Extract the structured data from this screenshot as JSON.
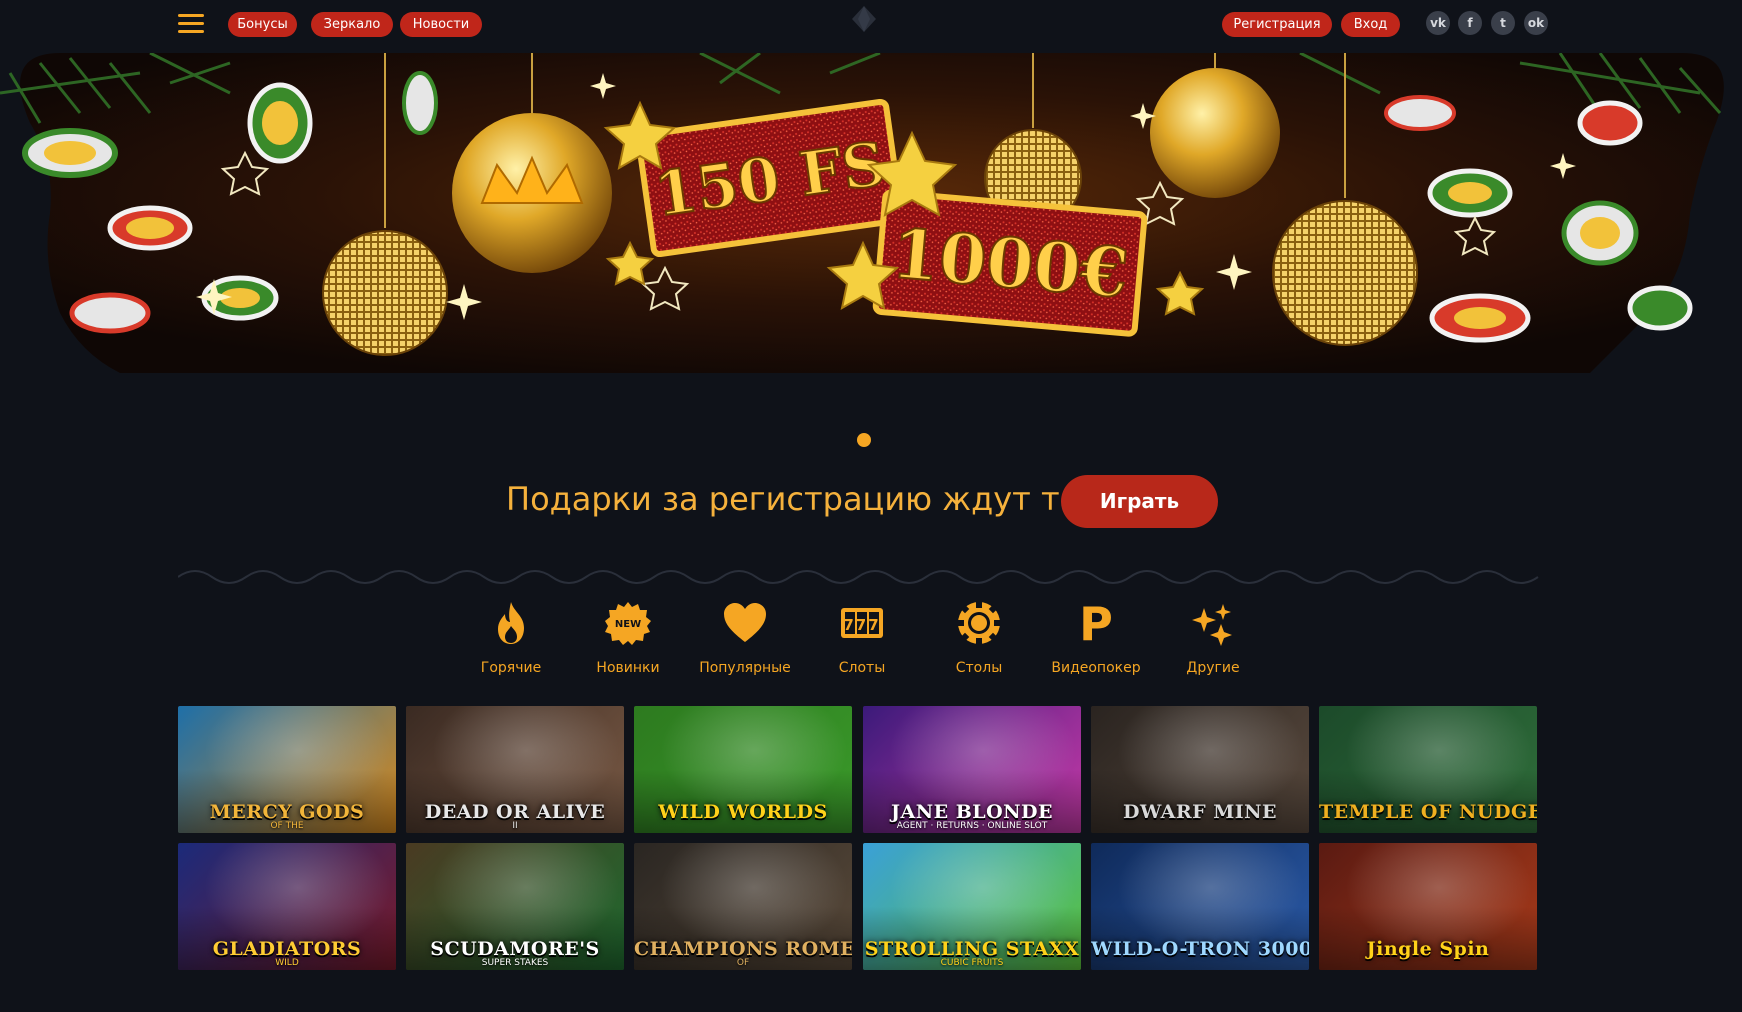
{
  "header": {
    "nav": [
      "Бонусы",
      "Зеркало",
      "Новости"
    ],
    "auth": [
      "Регистрация",
      "Вход"
    ],
    "social": [
      {
        "icon": "vk-icon",
        "glyph": "vk"
      },
      {
        "icon": "facebook-icon",
        "glyph": "f"
      },
      {
        "icon": "twitter-icon",
        "glyph": "t"
      },
      {
        "icon": "odnoklassniki-icon",
        "glyph": "ok"
      }
    ]
  },
  "banner": {
    "free_spins": "150 FS",
    "amount": "1000€"
  },
  "promo": {
    "text": "Подарки за регистрацию ждут тебя!",
    "button": "Играть"
  },
  "categories": [
    {
      "label": "Горячие",
      "icon": "fire-icon"
    },
    {
      "label": "Новинки",
      "icon": "new-badge-icon",
      "badge": "NEW"
    },
    {
      "label": "Популярные",
      "icon": "heart-icon"
    },
    {
      "label": "Слоты",
      "icon": "slot-777-icon",
      "badge": "777"
    },
    {
      "label": "Столы",
      "icon": "casino-chip-icon"
    },
    {
      "label": "Видеопокер",
      "icon": "poker-p-icon",
      "badge": "P"
    },
    {
      "label": "Другие",
      "icon": "sparkles-icon"
    }
  ],
  "games": [
    {
      "title": "MERCY GODS",
      "sub": "OF THE",
      "bg1": "#1e6fa8",
      "bg2": "#d98a1c",
      "text": "#f2b53a"
    },
    {
      "title": "DEAD OR ALIVE",
      "sub": "II",
      "bg1": "#3a2a22",
      "bg2": "#7a5a45",
      "text": "#e8e8e8"
    },
    {
      "title": "WILD WORLDS",
      "sub": "",
      "bg1": "#2d7a1f",
      "bg2": "#3a9a2a",
      "text": "#ffd21a"
    },
    {
      "title": "JANE BLONDE",
      "sub": "AGENT · RETURNS · ONLINE SLOT",
      "bg1": "#3b1a7a",
      "bg2": "#c73aa8",
      "text": "#ffffff"
    },
    {
      "title": "DWARF MINE",
      "sub": "",
      "bg1": "#2a2420",
      "bg2": "#5a4a3e",
      "text": "#d8d8d8"
    },
    {
      "title": "TEMPLE OF NUDGES",
      "sub": "",
      "bg1": "#1c4a2a",
      "bg2": "#2f6e3a",
      "text": "#f0b020"
    },
    {
      "title": "GLADIATORS",
      "sub": "WILD",
      "bg1": "#1b2a7a",
      "bg2": "#7a1a2a",
      "text": "#ffcc33"
    },
    {
      "title": "SCUDAMORE'S",
      "sub": "SUPER STAKES",
      "bg1": "#4a3a22",
      "bg2": "#1f6a2f",
      "text": "#ffffff"
    },
    {
      "title": "CHAMPIONS ROME",
      "sub": "OF",
      "bg1": "#2a2622",
      "bg2": "#5a4a3a",
      "text": "#e0b060"
    },
    {
      "title": "STROLLING STAXX",
      "sub": "CUBIC FRUITS",
      "bg1": "#3aa0d8",
      "bg2": "#5ac43a",
      "text": "#ffd21a"
    },
    {
      "title": "WILD-O-TRON 3000",
      "sub": "",
      "bg1": "#0f2a5a",
      "bg2": "#2a5aa8",
      "text": "#9fd8ff"
    },
    {
      "title": "Jingle Spin",
      "sub": "",
      "bg1": "#5a1a12",
      "bg2": "#a83a1a",
      "text": "#ffd21a"
    }
  ]
}
